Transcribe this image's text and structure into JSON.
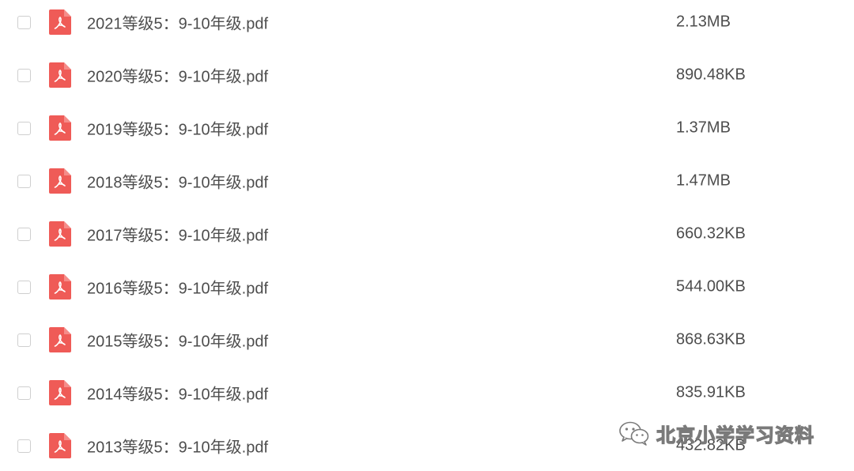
{
  "files": [
    {
      "name": "2021等级5：9-10年级.pdf",
      "size": "2.13MB",
      "icon": "pdf-icon"
    },
    {
      "name": "2020等级5：9-10年级.pdf",
      "size": "890.48KB",
      "icon": "pdf-icon"
    },
    {
      "name": "2019等级5：9-10年级.pdf",
      "size": "1.37MB",
      "icon": "pdf-icon"
    },
    {
      "name": "2018等级5：9-10年级.pdf",
      "size": "1.47MB",
      "icon": "pdf-icon"
    },
    {
      "name": "2017等级5：9-10年级.pdf",
      "size": "660.32KB",
      "icon": "pdf-icon"
    },
    {
      "name": "2016等级5：9-10年级.pdf",
      "size": "544.00KB",
      "icon": "pdf-icon"
    },
    {
      "name": "2015等级5：9-10年级.pdf",
      "size": "868.63KB",
      "icon": "pdf-icon"
    },
    {
      "name": "2014等级5：9-10年级.pdf",
      "size": "835.91KB",
      "icon": "pdf-icon"
    },
    {
      "name": "2013等级5：9-10年级.pdf",
      "size": "432.82KB",
      "icon": "pdf-icon"
    }
  ],
  "watermark": {
    "text": "北京小学学习资料",
    "icon": "wechat-icon"
  },
  "colors": {
    "pdf_icon": "#ef5b57",
    "text": "#4d4d4d",
    "checkbox_border": "#cfcfcf"
  }
}
